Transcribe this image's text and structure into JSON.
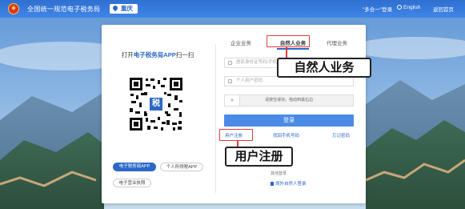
{
  "header": {
    "site_title": "全国统一规范电子税务局",
    "region": "重庆",
    "integrated_link": "\"多合一\"登录",
    "language": "English",
    "homepage_link": "返回首页"
  },
  "qr_panel": {
    "title_prefix": "打开",
    "title_app": "电子税务局APP",
    "title_suffix": "扫一扫",
    "qr_center_char": "税",
    "app_buttons": [
      "电子税务局APP",
      "个人所得税APP",
      "电子营业执照"
    ]
  },
  "login_panel": {
    "tabs": [
      "企业业务",
      "自然人业务",
      "代理业务"
    ],
    "active_tab": "自然人业务",
    "account_placeholder": "居民身份证号码/手机号码/用户名",
    "password_placeholder": "个人用户密码",
    "slider_text": "请按住滑块，拖动到最右边",
    "slider_handle": "»",
    "login_button": "登录",
    "register_link": "用户注册",
    "find_account_link": "找回手机号码",
    "forgot_password_link": "忘记密码",
    "other_login_label": "其他登录",
    "foreigner_link": "境外自然人登录"
  },
  "annotations": {
    "tab_callout": "自然人业务",
    "register_callout": "用户注册",
    "highlight_color": "#e23b3b"
  },
  "colors": {
    "header_blue": "#3f86e8",
    "accent": "#2c68c8",
    "button": "#4a8be6"
  }
}
